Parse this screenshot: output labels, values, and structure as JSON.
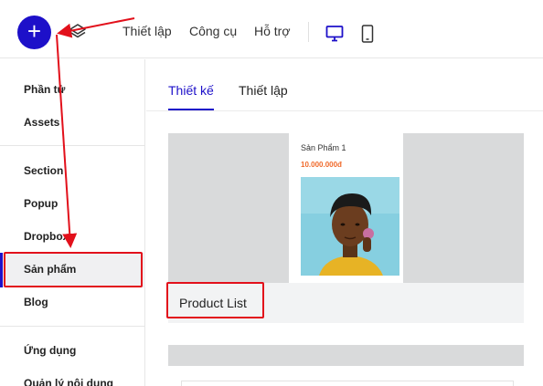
{
  "toolbar": {
    "add_label": "+",
    "menu": [
      "Thiết lập",
      "Công cụ",
      "Hỗ trợ"
    ]
  },
  "sidebar": {
    "items": [
      "Phần tử",
      "Assets",
      "Section",
      "Popup",
      "Dropbox",
      "Sản phẩm",
      "Blog",
      "Ứng dụng",
      "Quản lý nội dung"
    ],
    "active": "Sản phẩm"
  },
  "tabs": [
    "Thiết kế",
    "Thiết lập"
  ],
  "preview": {
    "product_name": "Sản Phẩm 1",
    "product_price": "10.000.000đ",
    "element_label": "Product List"
  },
  "colors": {
    "accent": "#1d10c9",
    "price": "#f0692a",
    "annotation": "#e2101b"
  },
  "icons": [
    "plus-icon",
    "layers-icon",
    "desktop-icon",
    "mobile-icon"
  ]
}
